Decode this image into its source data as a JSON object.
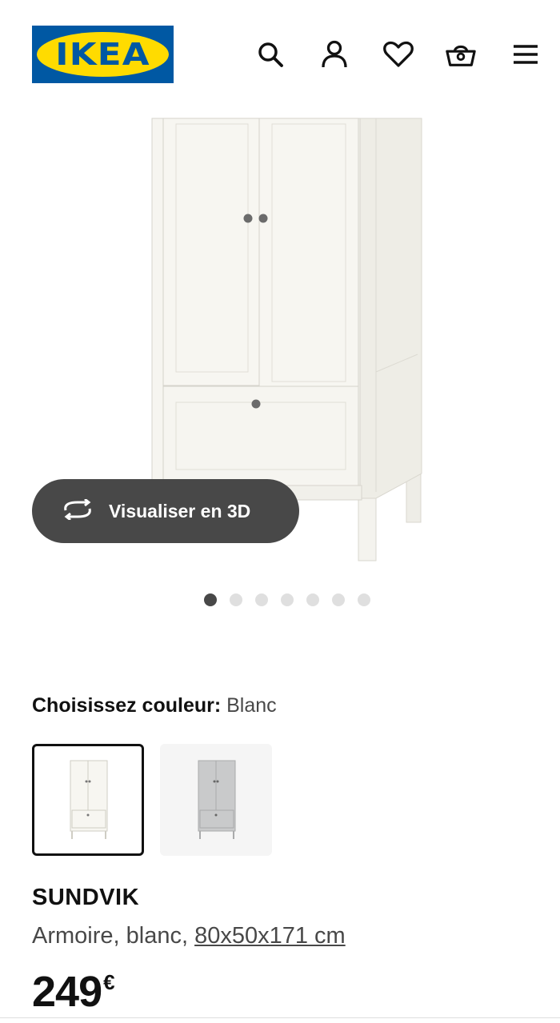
{
  "header": {
    "logo_text": "IKEA",
    "icons": [
      "search-icon",
      "account-icon",
      "heart-icon",
      "basket-icon",
      "menu-icon"
    ]
  },
  "gallery": {
    "viz3d_label": "Visualiser en 3D",
    "dot_count": 7,
    "active_dot": 1
  },
  "color_selector": {
    "label": "Choisissez couleur:",
    "value": "Blanc",
    "options": [
      "Blanc",
      "Gris"
    ],
    "selected_index": 0
  },
  "product": {
    "name": "SUNDVIK",
    "description": "Armoire, blanc, ",
    "dimensions": "80x50x171 cm",
    "price_int": "249",
    "price_currency": "€"
  },
  "colors": {
    "ikea_blue": "#0058a3",
    "ikea_yellow": "#ffdb00",
    "button_dark": "#484848",
    "text": "#111111"
  }
}
